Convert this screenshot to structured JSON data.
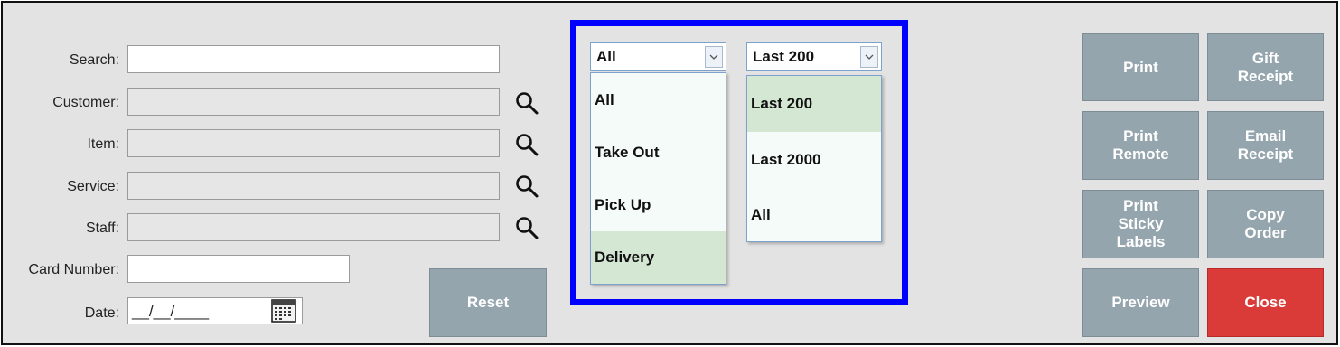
{
  "form": {
    "search_label": "Search:",
    "customer_label": "Customer:",
    "item_label": "Item:",
    "service_label": "Service:",
    "staff_label": "Staff:",
    "card_label": "Card Number:",
    "date_label": "Date:",
    "date_value": "__/__/____"
  },
  "reset_label": "Reset",
  "order_type": {
    "selected": "All",
    "options": [
      "All",
      "Take Out",
      "Pick Up",
      "Delivery"
    ],
    "highlighted": "Delivery"
  },
  "range": {
    "selected": "Last 200",
    "options": [
      "Last 200",
      "Last 2000",
      "All"
    ],
    "highlighted": "Last 200"
  },
  "buttons": {
    "print": "Print",
    "gift_receipt": "Gift\nReceipt",
    "print_remote": "Print\nRemote",
    "email_receipt": "Email\nReceipt",
    "print_sticky": "Print\nSticky\nLabels",
    "copy_order": "Copy\nOrder",
    "preview": "Preview",
    "close": "Close"
  },
  "colors": {
    "button": "#95a5ae",
    "close_button": "#da3a38",
    "highlight_border": "#0000ff",
    "selected_option": "#d3e7d3"
  },
  "icons": [
    "magnifier-icon",
    "calendar-icon",
    "chevron-down-icon"
  ]
}
